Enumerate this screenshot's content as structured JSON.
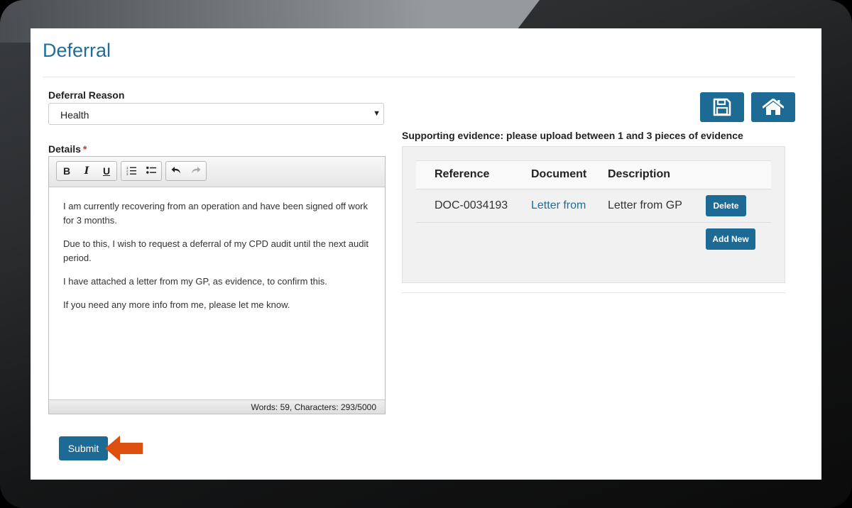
{
  "page": {
    "title": "Deferral"
  },
  "form": {
    "reason_label": "Deferral Reason",
    "reason_value": "Health",
    "details_label": "Details",
    "required_marker": "*"
  },
  "editor": {
    "toolbar": {
      "bold": "B",
      "italic": "I",
      "underline": "U",
      "icons": [
        "numbered-list-icon",
        "bullet-list-icon",
        "undo-icon",
        "redo-icon"
      ]
    },
    "paragraphs": [
      "I am currently recovering from an operation and have been signed off work for 3 months.",
      "Due to this, I wish to request a deferral of my CPD audit until the next audit period.",
      "I have attached a letter from my GP, as evidence, to confirm this.",
      "If you need any more info from me, please let me know."
    ],
    "status": "Words: 59, Characters: 293/5000"
  },
  "actions": {
    "submit_label": "Submit",
    "icons": [
      "save-icon",
      "home-icon"
    ]
  },
  "evidence": {
    "label": "Supporting evidence: please upload between 1 and 3 pieces of evidence",
    "columns": [
      "Reference",
      "Document",
      "Description"
    ],
    "rows": [
      {
        "reference": "DOC-0034193",
        "document": "Letter from",
        "description": "Letter from GP",
        "action": "Delete"
      }
    ],
    "add_new_label": "Add New"
  },
  "colors": {
    "accent": "#1d6a95",
    "title": "#1f6e9a",
    "annotation_arrow": "#dd4f0f"
  }
}
